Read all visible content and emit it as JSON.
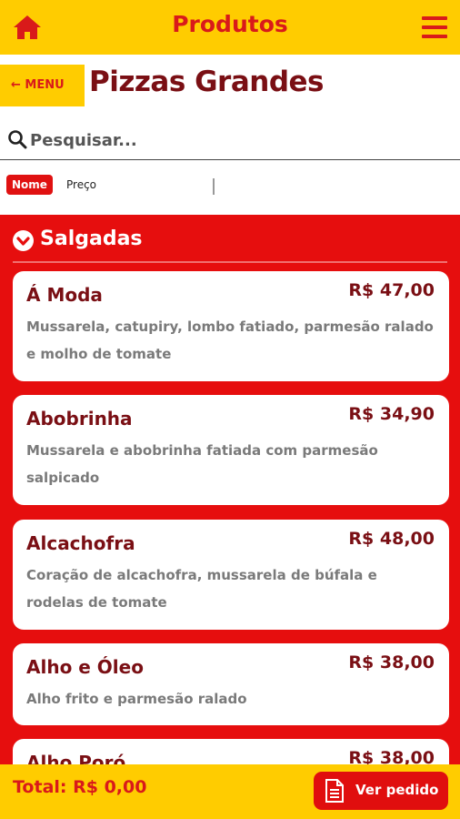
{
  "header": {
    "title": "Produtos"
  },
  "menu_label": "← MENU",
  "page_title": "Pizzas Grandes",
  "search": {
    "placeholder": "Pesquisar..."
  },
  "sort": {
    "active": "Nome",
    "other": "Preço"
  },
  "category": {
    "name": "Salgadas"
  },
  "products": [
    {
      "name": "Á Moda",
      "price": "R$ 47,00",
      "description": "Mussarela, catupiry, lombo fatiado, parmesão ralado e molho de tomate"
    },
    {
      "name": "Abobrinha",
      "price": "R$ 34,90",
      "description": "Mussarela e abobrinha fatiada com parmesão salpicado"
    },
    {
      "name": "Alcachofra",
      "price": "R$ 48,00",
      "description": "Coração de alcachofra, mussarela de búfala e rodelas de tomate"
    },
    {
      "name": "Alho e Óleo",
      "price": "R$ 38,00",
      "description": "Alho frito e parmesão ralado"
    },
    {
      "name": "Alho Poró",
      "price": "R$ 38,00",
      "description": ""
    }
  ],
  "footer": {
    "total": "Total: R$ 0,00",
    "order_button": "Ver pedido"
  },
  "colors": {
    "yellow": "#ffcc00",
    "red": "#e60e0e",
    "dark_red": "#7a0f14"
  }
}
